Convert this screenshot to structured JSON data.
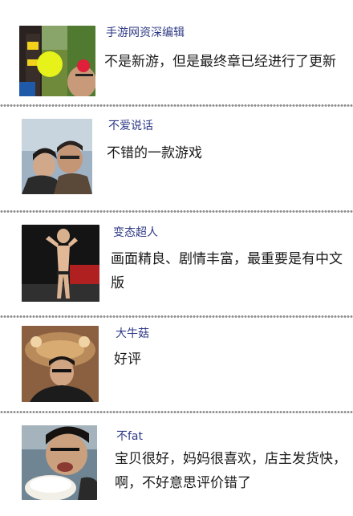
{
  "reviews": [
    {
      "author": "手游网资深编辑",
      "comment": "不是新游，但是最终章已经进行了更新"
    },
    {
      "author": "不爱说话",
      "comment": "不错的一款游戏"
    },
    {
      "author": "变态超人",
      "comment": "画面精良、剧情丰富，最重要是有中文版"
    },
    {
      "author": "大牛菇",
      "comment": "好评"
    },
    {
      "author": "不fat",
      "comment": "宝贝很好，妈妈很喜欢，店主发货快，啊，不好意思评价错了"
    }
  ],
  "colors": {
    "author_text": "#2f3a86",
    "comment_text": "#1a1a1a",
    "divider_dots": "#8e8e8e"
  }
}
